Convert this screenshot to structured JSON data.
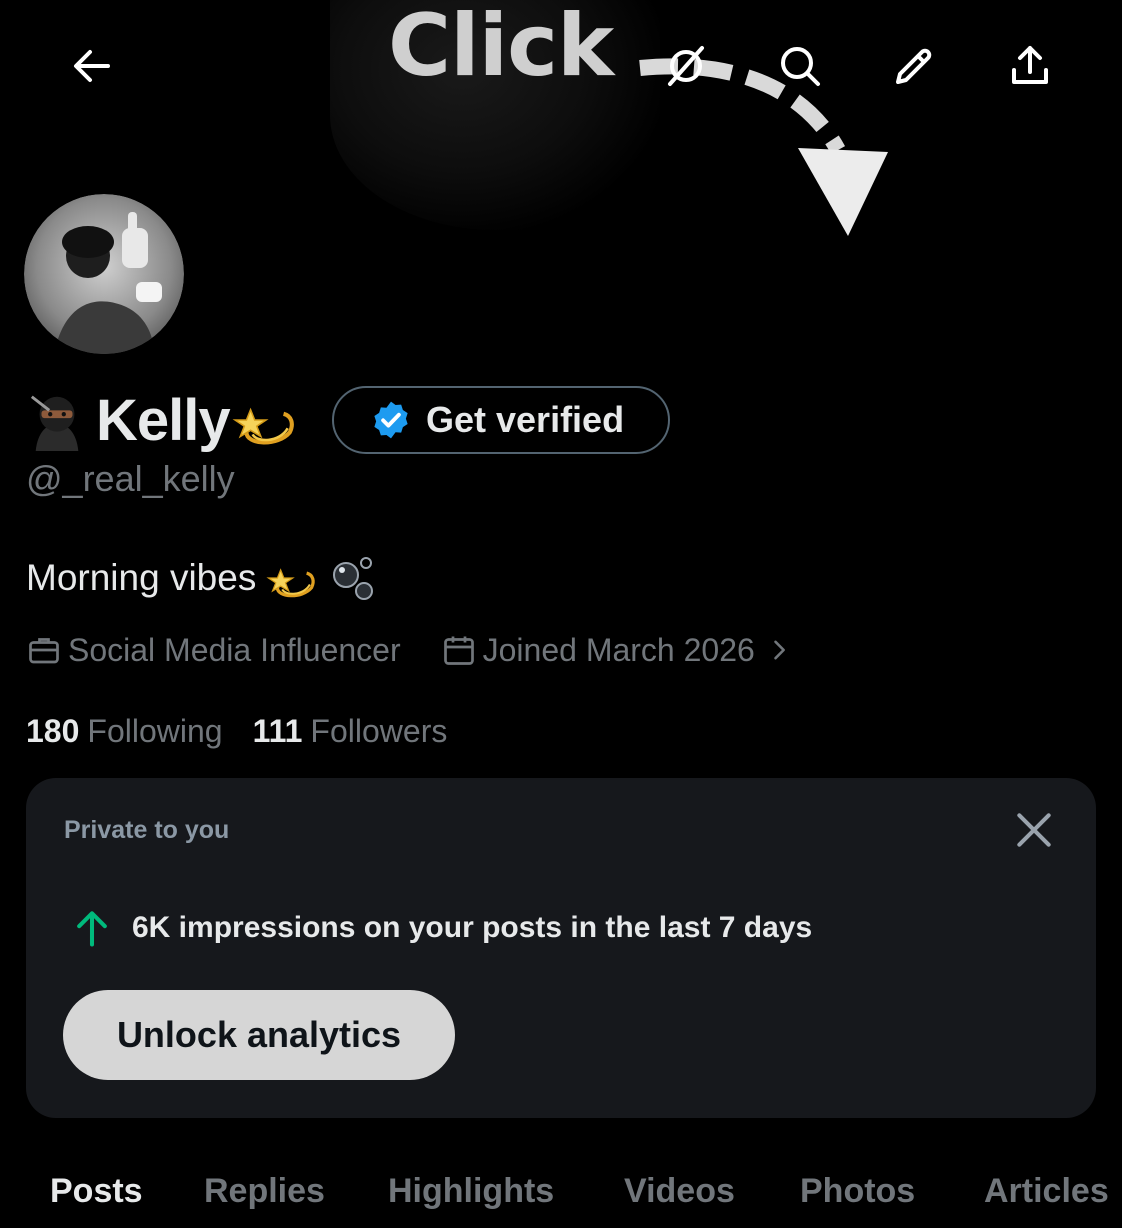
{
  "banner": {
    "overlay_text": "Click"
  },
  "top_bar": {
    "back_icon": "arrow-left-icon",
    "grok_icon": "slash-circle-icon",
    "search_icon": "search-icon",
    "edit_icon": "pencil-icon",
    "share_icon": "share-upload-icon"
  },
  "profile": {
    "display_name": "Kelly",
    "handle": "@_real_kelly",
    "bio": "Morning vibes",
    "verify_label": "Get verified",
    "occupation": "Social Media Influencer",
    "joined": "Joined March 2026",
    "following_count": "180",
    "following_label": "Following",
    "followers_count": "111",
    "followers_label": "Followers"
  },
  "private_card": {
    "header": "Private to you",
    "stat_text": "6K impressions on your posts in the last 7 days",
    "button_label": "Unlock analytics"
  },
  "tabs": [
    {
      "label": "Posts"
    },
    {
      "label": "Replies"
    },
    {
      "label": "Highlights"
    },
    {
      "label": "Videos"
    },
    {
      "label": "Photos"
    },
    {
      "label": "Articles"
    }
  ],
  "colors": {
    "background": "#000000",
    "card": "#16181c",
    "secondary_text": "#71767b",
    "verified_blue": "#1d9bf0",
    "growth_green": "#00ba7c"
  }
}
